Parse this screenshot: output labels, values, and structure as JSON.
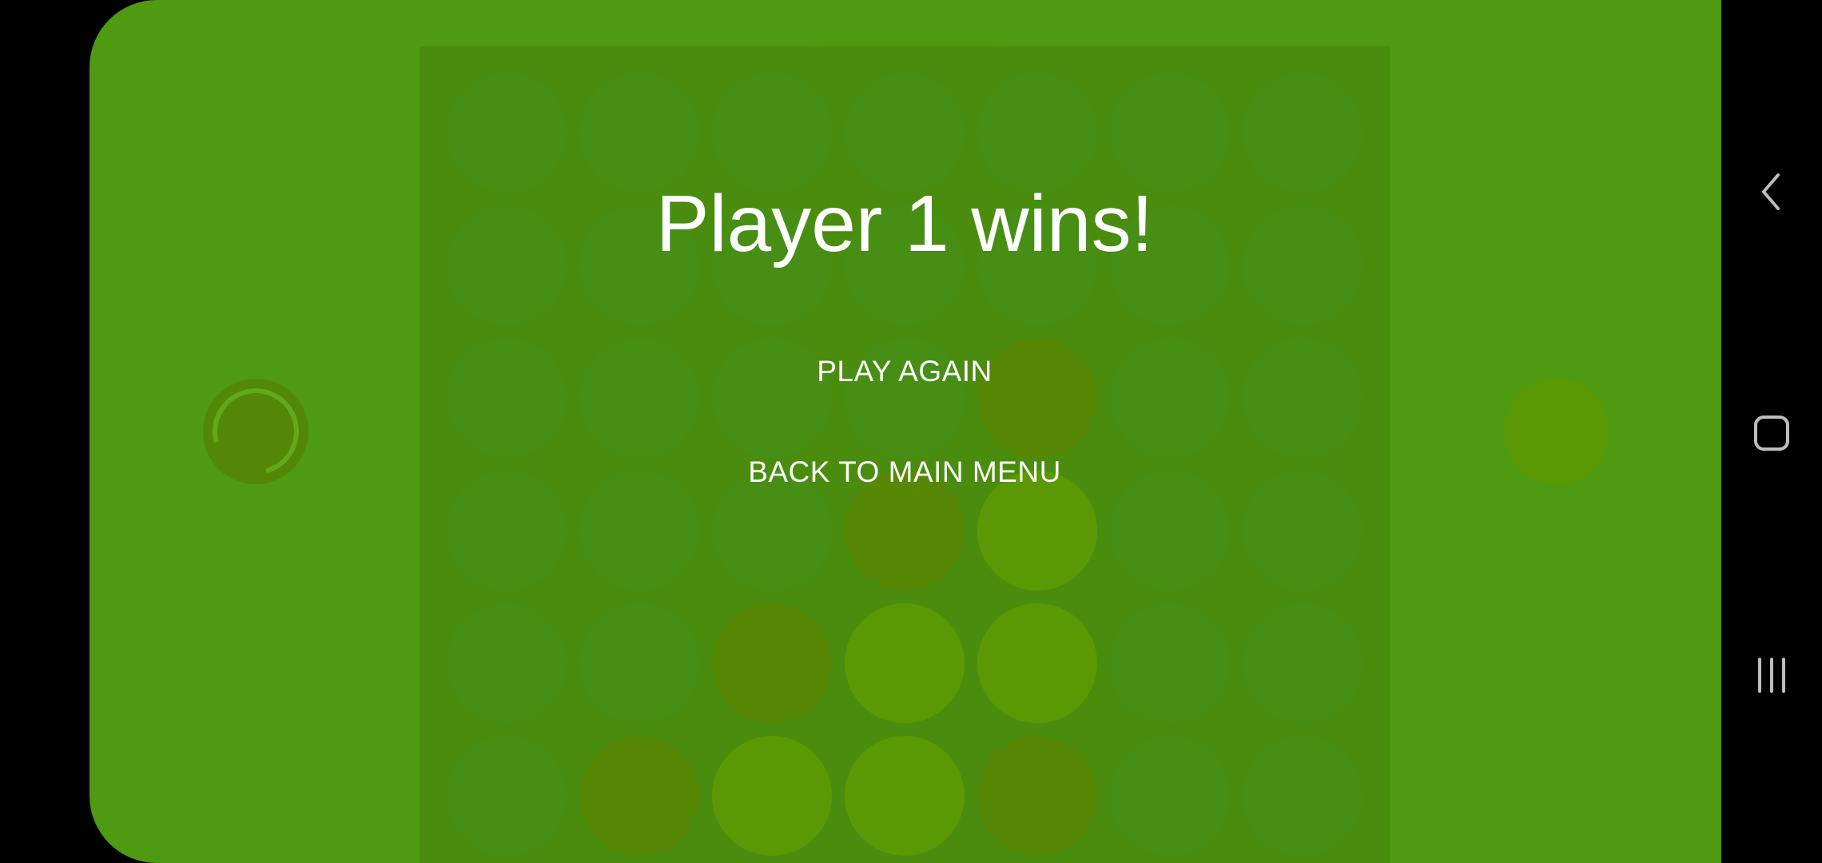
{
  "game": {
    "result_title": "Player 1 wins!",
    "play_again_label": "PLAY AGAIN",
    "back_to_menu_label": "BACK TO MAIN MENU",
    "board": {
      "columns": 7,
      "visible_rows": 6,
      "cells": [
        [
          "empty",
          "empty",
          "empty",
          "empty",
          "empty",
          "empty",
          "empty"
        ],
        [
          "empty",
          "empty",
          "empty",
          "empty",
          "empty",
          "empty",
          "empty"
        ],
        [
          "empty",
          "empty",
          "empty",
          "empty",
          "p2",
          "empty",
          "empty"
        ],
        [
          "empty",
          "empty",
          "empty",
          "p2",
          "p1",
          "empty",
          "empty"
        ],
        [
          "empty",
          "empty",
          "p2",
          "p1",
          "p1",
          "empty",
          "empty"
        ],
        [
          "empty",
          "p2",
          "p1",
          "p1",
          "p2",
          "empty",
          "empty"
        ]
      ]
    },
    "player1_indicator": {
      "state": "loading"
    },
    "player2_indicator": {
      "state": "idle"
    }
  },
  "colors": {
    "background": "#4e9a10",
    "board": "#4a8c0e",
    "empty_slot": "#468f14",
    "player1_disc": "#5a9904",
    "player2_disc": "#578805",
    "text": "#ffffff"
  },
  "system_nav": {
    "icons": [
      "back-icon",
      "home-icon",
      "recents-icon"
    ]
  }
}
